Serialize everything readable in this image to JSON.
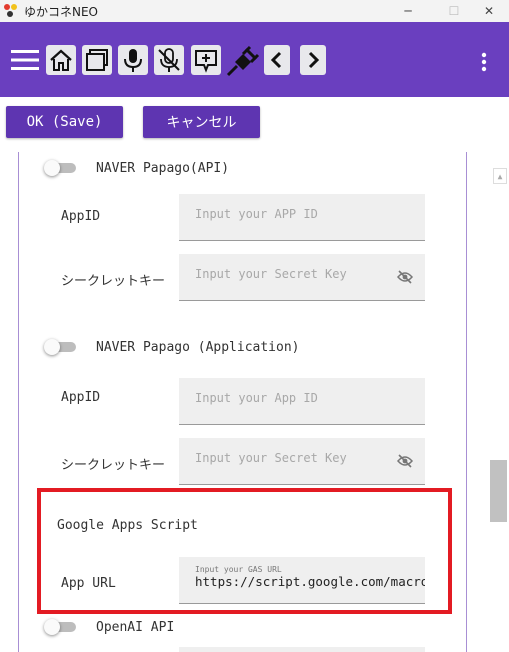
{
  "window": {
    "title": "ゆかコネNEO",
    "controls": [
      "─",
      "☐",
      "✕"
    ]
  },
  "toolbar": {
    "icons": [
      "menu-icon",
      "home-icon",
      "window-icon",
      "microphone-icon",
      "microphone-off-icon",
      "add-comment-icon",
      "plug-icon",
      "chevron-left-icon",
      "chevron-right-icon",
      "more-vert-icon"
    ]
  },
  "actions": {
    "ok_label": "OK (Save)",
    "cancel_label": "キャンセル"
  },
  "settings": {
    "papago_api": {
      "title": "NAVER Papago(API)",
      "appid_label": "AppID",
      "appid_placeholder": "Input your APP ID",
      "secret_label": "シークレットキー",
      "secret_placeholder": "Input your Secret Key"
    },
    "papago_app": {
      "title": "NAVER Papago (Application)",
      "appid_label": "AppID",
      "appid_placeholder": "Input your App ID",
      "secret_label": "シークレットキー",
      "secret_placeholder": "Input your Secret Key"
    },
    "gas": {
      "title": "Google Apps Script",
      "url_label": "App URL",
      "url_hint": "Input your GAS URL",
      "url_value": "https://script.google.com/macros/s"
    },
    "openai": {
      "title": "OpenAI API"
    }
  },
  "colors": {
    "toolbar": "#6a3fbf",
    "button": "#5e35b1",
    "highlight": "#e31b23"
  }
}
